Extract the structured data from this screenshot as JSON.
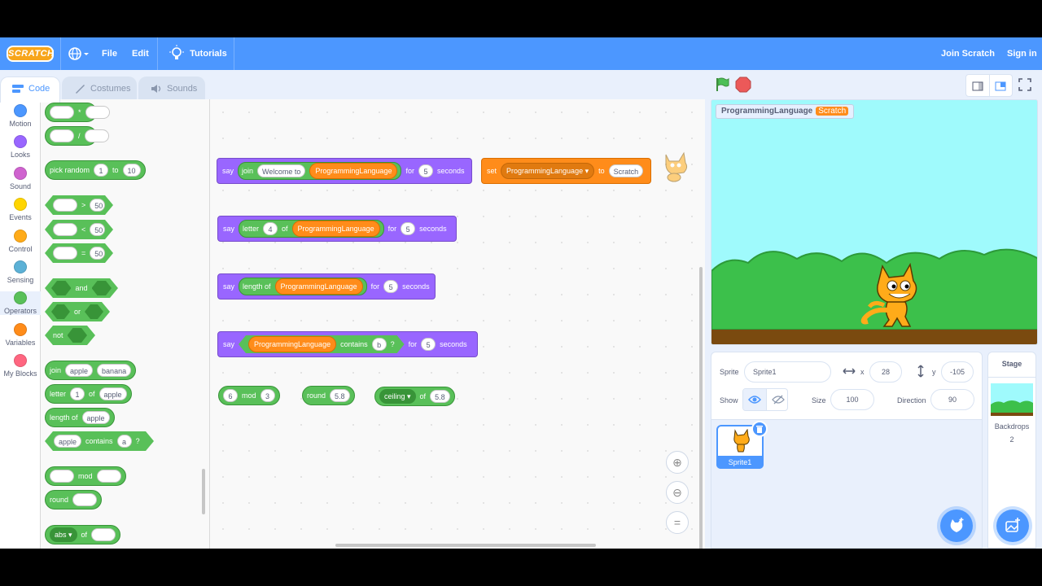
{
  "menubar": {
    "logo": "SCRATCH",
    "file": "File",
    "edit": "Edit",
    "tutorials": "Tutorials",
    "join": "Join Scratch",
    "signin": "Sign in"
  },
  "tabs": {
    "code": "Code",
    "costumes": "Costumes",
    "sounds": "Sounds"
  },
  "categories": [
    {
      "label": "Motion",
      "color": "#4c97ff"
    },
    {
      "label": "Looks",
      "color": "#9966ff"
    },
    {
      "label": "Sound",
      "color": "#cf63cf"
    },
    {
      "label": "Events",
      "color": "#ffd500"
    },
    {
      "label": "Control",
      "color": "#ffab19"
    },
    {
      "label": "Sensing",
      "color": "#5cb1d6"
    },
    {
      "label": "Operators",
      "color": "#59c059"
    },
    {
      "label": "Variables",
      "color": "#ff8c1a"
    },
    {
      "label": "My Blocks",
      "color": "#ff6680"
    }
  ],
  "palette": {
    "mul": "*",
    "div": "/",
    "pick_random": "pick random",
    "pick_from": "1",
    "pick_to_word": "to",
    "pick_to": "10",
    "gt": ">",
    "lt": "<",
    "eq": "=",
    "cmp_value": "50",
    "and": "and",
    "or": "or",
    "not": "not",
    "join": "join",
    "join_a": "apple",
    "join_b": "banana",
    "letter": "letter",
    "letter_n": "1",
    "of": "of",
    "letter_s": "apple",
    "length_of": "length of",
    "length_s": "apple",
    "contains_a": "apple",
    "contains": "contains",
    "contains_b": "a",
    "q": "?",
    "mod": "mod",
    "round": "round",
    "abs": "abs"
  },
  "script": {
    "say": "say",
    "for": "for",
    "seconds": "seconds",
    "join": "join",
    "welcome": "Welcome to",
    "var": "ProgrammingLanguage",
    "secs1": "5",
    "set": "set",
    "to": "to",
    "set_value": "Scratch",
    "letter": "letter",
    "letter_n": "4",
    "of": "of",
    "secs2": "5",
    "length_of": "length of",
    "secs3": "5",
    "contains": "contains",
    "contains_v": "b",
    "q": "?",
    "secs4": "5",
    "mod_a": "6",
    "mod": "mod",
    "mod_b": "3",
    "round": "round",
    "round_v": "5.8",
    "ceiling": "ceiling",
    "ceil_of": "of",
    "ceil_v": "5.8"
  },
  "stage": {
    "monitor_label": "ProgrammingLanguage",
    "monitor_value": "Scratch"
  },
  "sprite_info": {
    "sprite_label": "Sprite",
    "sprite_name": "Sprite1",
    "x_label": "x",
    "x": "28",
    "y_label": "y",
    "y": "-105",
    "show_label": "Show",
    "size_label": "Size",
    "size": "100",
    "direction_label": "Direction",
    "direction": "90"
  },
  "sprite_list": {
    "thumb_label": "Sprite1"
  },
  "stage_panel": {
    "title": "Stage",
    "backdrops_label": "Backdrops",
    "backdrops": "2"
  }
}
